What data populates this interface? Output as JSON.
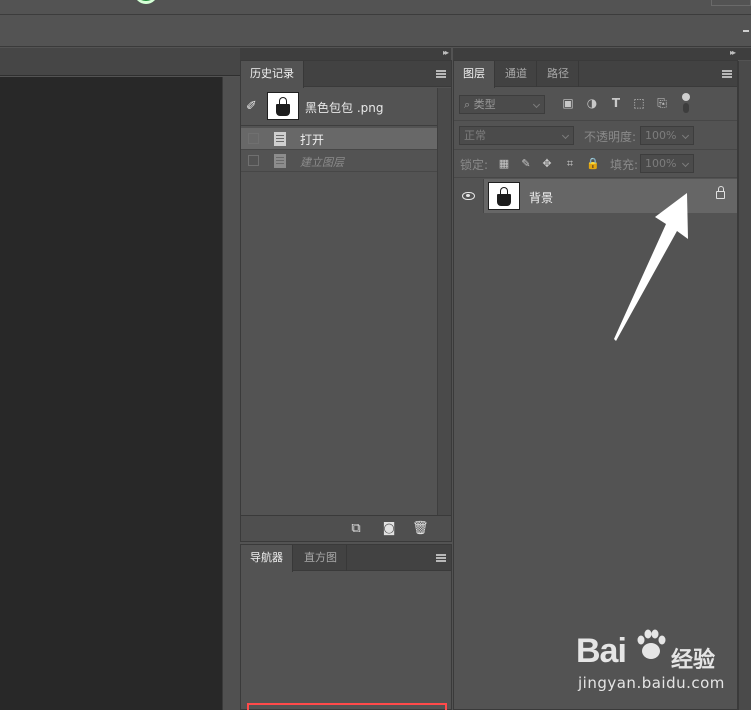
{
  "history_panel": {
    "tabs": [
      "历史记录"
    ],
    "snapshot_label": "黑色包包 .png",
    "items": [
      {
        "label": "打开",
        "state": "current"
      },
      {
        "label": "建立图层",
        "state": "future"
      }
    ],
    "footer_icons": [
      "new-document-from-state-icon",
      "snapshot-camera-icon",
      "trash-icon"
    ]
  },
  "navigator_panel": {
    "tabs": [
      "导航器",
      "直方图"
    ],
    "proxy_color": "#ff4a4a"
  },
  "layers_panel": {
    "tabs": [
      "图层",
      "通道",
      "路径"
    ],
    "filter_type": "类型",
    "filter_icons": [
      "image-filter-icon",
      "adjustment-filter-icon",
      "type-filter-icon",
      "shape-filter-icon",
      "smart-object-filter-icon"
    ],
    "blend_mode": "正常",
    "opacity_label": "不透明度:",
    "opacity_value": "100%",
    "lock_label": "锁定:",
    "lock_icons": [
      "lock-transparent-icon",
      "lock-image-icon",
      "lock-position-icon",
      "lock-artboard-icon",
      "lock-all-icon"
    ],
    "fill_label": "填充:",
    "fill_value": "100%",
    "layers": [
      {
        "name": "背景",
        "visible": true,
        "locked": true
      }
    ]
  },
  "watermark": {
    "brand": "Bai",
    "brand_cn": "经验",
    "url": "jingyan.baidu.com"
  },
  "colors": {
    "panel_bg": "#535353",
    "canvas_bg": "#282828",
    "selected_row": "#686868",
    "annotation_arrow": "#ffffff"
  }
}
